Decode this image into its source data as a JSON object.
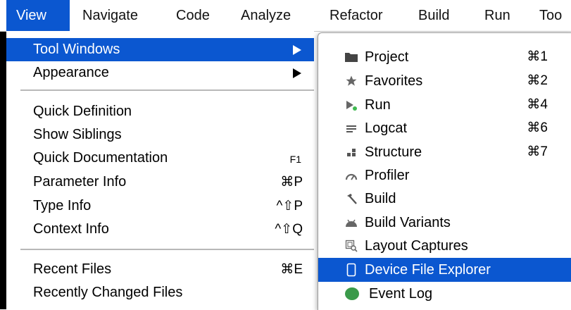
{
  "menubar": {
    "items": [
      {
        "label": "View"
      },
      {
        "label": "Navigate"
      },
      {
        "label": "Code"
      },
      {
        "label": "Analyze"
      },
      {
        "label": "Refactor"
      },
      {
        "label": "Build"
      },
      {
        "label": "Run"
      },
      {
        "label": "Too"
      }
    ]
  },
  "view_menu": {
    "items": [
      {
        "label": "Tool Windows",
        "shortcut": ""
      },
      {
        "label": "Appearance",
        "shortcut": ""
      },
      {
        "label": "Quick Definition",
        "shortcut": ""
      },
      {
        "label": "Show Siblings",
        "shortcut": ""
      },
      {
        "label": "Quick Documentation",
        "shortcut": "F1"
      },
      {
        "label": "Parameter Info",
        "shortcut": "⌘P"
      },
      {
        "label": "Type Info",
        "shortcut": "^⇧P"
      },
      {
        "label": "Context Info",
        "shortcut": "^⇧Q"
      },
      {
        "label": "Recent Files",
        "shortcut": "⌘E"
      },
      {
        "label": "Recently Changed Files",
        "shortcut": ""
      }
    ]
  },
  "tool_windows_submenu": {
    "items": [
      {
        "label": "Project",
        "shortcut": "⌘1",
        "icon": "folder-icon"
      },
      {
        "label": "Favorites",
        "shortcut": "⌘2",
        "icon": "star-icon"
      },
      {
        "label": "Run",
        "shortcut": "⌘4",
        "icon": "run-icon"
      },
      {
        "label": "Logcat",
        "shortcut": "⌘6",
        "icon": "logcat-icon"
      },
      {
        "label": "Structure",
        "shortcut": "⌘7",
        "icon": "structure-icon"
      },
      {
        "label": "Profiler",
        "shortcut": "",
        "icon": "profiler-icon"
      },
      {
        "label": "Build",
        "shortcut": "",
        "icon": "hammer-icon"
      },
      {
        "label": "Build Variants",
        "shortcut": "",
        "icon": "android-icon"
      },
      {
        "label": "Layout Captures",
        "shortcut": "",
        "icon": "layout-captures-icon"
      },
      {
        "label": "Device File Explorer",
        "shortcut": "",
        "icon": "device-icon"
      },
      {
        "label": "Event Log",
        "shortcut": "",
        "icon": "event-log-icon"
      }
    ]
  },
  "colors": {
    "highlight": "#0b57d0",
    "run_dot": "#3fb950",
    "event_log": "#3a9a4a"
  }
}
